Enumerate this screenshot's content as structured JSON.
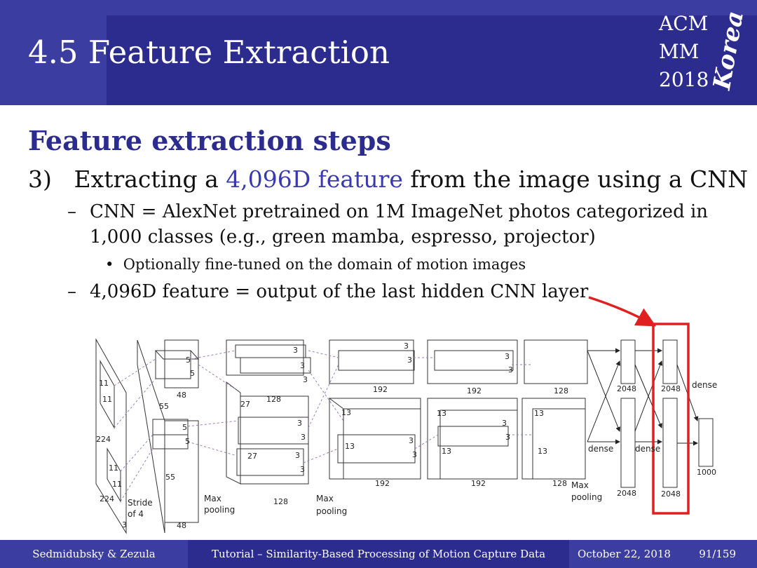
{
  "header": {
    "title": "4.5 Feature Extraction",
    "logo": {
      "line1": "ACM",
      "line2": "MM",
      "line3": "2018",
      "script": "Korea"
    }
  },
  "body": {
    "section_heading": "Feature extraction steps",
    "step": {
      "number": "3)",
      "text_before": "Extracting a",
      "highlight": "4,096D feature",
      "text_after": "from the image using a CNN"
    },
    "sub1": {
      "dash": "–",
      "text": "CNN = AlexNet pretrained on 1M ImageNet photos categorized in 1,000 classes (e.g., green mamba, espresso, projector)"
    },
    "bullet": "Optionally fine-tuned on the domain of motion images",
    "sub2": {
      "dash": "–",
      "text": "4,096D feature = output of the last hidden CNN layer"
    }
  },
  "diagram": {
    "labels": {
      "n11a": "11",
      "n11b": "11",
      "n224a": "224",
      "n11c": "11",
      "n11d": "11",
      "n224b": "224",
      "stride1": "Stride",
      "stride2": "of 4",
      "n3": "3",
      "n5a": "5",
      "n5b": "5",
      "n48a": "48",
      "n55a": "55",
      "n5c": "5",
      "n5d": "5",
      "n55b": "55",
      "n48b": "48",
      "maxpool1a": "Max",
      "maxpool1b": "pooling",
      "n3a": "3",
      "n3b": "3",
      "n3c": "3",
      "n27a": "27",
      "n128a": "128",
      "n3d": "3",
      "n3e": "3",
      "n27b": "27",
      "n3f": "3",
      "n3g": "3",
      "n128b": "128",
      "maxpool2a": "Max",
      "maxpool2b": "pooling",
      "n3h": "3",
      "n3i": "3",
      "n192a": "192",
      "n13a": "13",
      "n13b": "13",
      "n3j": "3",
      "n3k": "3",
      "n192b": "192",
      "n3l": "3",
      "n3m": "3",
      "n192c": "192",
      "n13c": "13",
      "n13d": "13",
      "n3n": "3",
      "n3o": "3",
      "n192d": "192",
      "n3p": "3",
      "n3q": "3",
      "n128c": "128",
      "n13e": "13",
      "n13f": "13",
      "n128d": "128",
      "maxpool3a": "Max",
      "maxpool3b": "pooling",
      "n2048a": "2048",
      "n2048b": "2048",
      "n2048c": "2048",
      "n2048d": "2048",
      "dense1": "dense",
      "dense2": "dense",
      "dense3": "dense",
      "n1000": "1000"
    }
  },
  "footer": {
    "authors": "Sedmidubsky & Zezula",
    "tutorial": "Tutorial – Similarity-Based Processing of Motion Capture Data",
    "date": "October 22, 2018",
    "page": "91/159"
  }
}
